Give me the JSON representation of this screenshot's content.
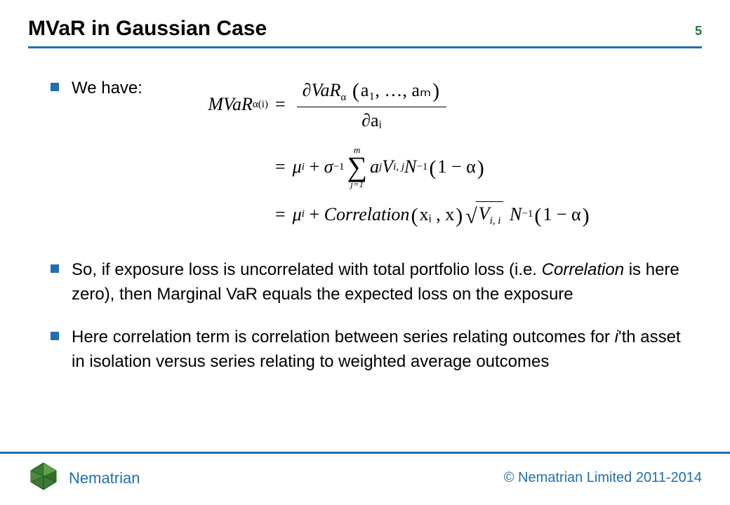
{
  "header": {
    "title": "MVaR in Gaussian Case",
    "page_number": "5"
  },
  "bullets": {
    "b1": "We have:",
    "b2_a": "So, if exposure loss is uncorrelated with total portfolio loss (i.e. ",
    "b2_em": "Correlation",
    "b2_b": " is here zero), then Marginal VaR equals the expected loss on the exposure",
    "b3_a": "Here correlation term is correlation between series relating outcomes for ",
    "b3_em": "i",
    "b3_b": "'th asset in isolation versus series relating to weighted average outcomes"
  },
  "math": {
    "lhs": "MVaR",
    "lhs_sub": "α",
    "lhs_sup": "(i)",
    "eq1_num_a": "∂VaR",
    "eq1_num_sub": "α",
    "eq1_num_args": "a₁, …, aₘ",
    "eq1_den": "∂aᵢ",
    "eq2_mu": "μ",
    "eq2_mu_sub": "i",
    "eq2_sigma": "σ",
    "eq2_sigma_exp": "−1",
    "eq2_sum_top": "m",
    "eq2_sum_bot": "j=1",
    "eq2_aj": "a",
    "eq2_aj_sub": "j",
    "eq2_V": "V",
    "eq2_V_sub": "i, j",
    "eq2_N": "N",
    "eq2_N_exp": "−1",
    "eq2_arg": "1 − α",
    "eq3_mu": "μ",
    "eq3_mu_sub": "i",
    "eq3_corr": "Correlation",
    "eq3_corr_args": "xᵢ , x",
    "eq3_V": "V",
    "eq3_V_sub": "i, i",
    "eq3_N": "N",
    "eq3_N_exp": "−1",
    "eq3_arg": "1 − α"
  },
  "footer": {
    "brand": "Nematrian",
    "copyright": "© Nematrian Limited 2011-2014"
  },
  "colors": {
    "accent_blue": "#1f6fb2",
    "accent_green": "#1f7a3f"
  }
}
